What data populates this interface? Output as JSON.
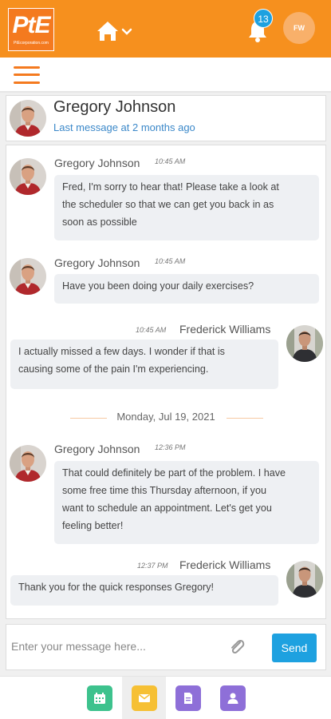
{
  "app": {
    "logo_text": "PtE",
    "logo_subtext": "PtEcorporation.com",
    "notifications_count": "13",
    "user_initials": "FW"
  },
  "conversation": {
    "name": "Gregory Johnson",
    "last_message": "Last message at 2 months ago"
  },
  "messages": [
    {
      "sender": "Gregory Johnson",
      "time": "10:45 AM",
      "side": "left",
      "lines": [
        "Fred, I'm sorry to hear that! Please take a look at",
        "the scheduler so that we can get you back in as",
        "soon as possible"
      ]
    },
    {
      "sender": "Gregory Johnson",
      "time": "10:45 AM",
      "side": "left",
      "lines": [
        "Have you been doing your daily exercises?"
      ]
    },
    {
      "sender": "Frederick Williams",
      "time": "10:45 AM",
      "side": "right",
      "lines": [
        "I actually missed a few days. I wonder if that is",
        "causing some of the pain I'm experiencing."
      ]
    },
    {
      "sender": "Gregory Johnson",
      "time": "12:36 PM",
      "side": "left",
      "lines": [
        "That could definitely be part of the problem. I have",
        "some free time this Thursday afternoon, if you",
        "want to schedule an appointment. Let's get you",
        "feeling better!"
      ]
    },
    {
      "sender": "Frederick Williams",
      "time": "12:37 PM",
      "side": "right",
      "lines": [
        "Thank you for the quick responses Gregory!"
      ]
    }
  ],
  "date_separator": "Monday, Jul 19, 2021",
  "composer": {
    "placeholder": "Enter your message here...",
    "send_label": "Send"
  },
  "bottom_nav": [
    {
      "name": "calendar",
      "icon": "calendar-icon",
      "color": "#3dc28d"
    },
    {
      "name": "messages",
      "icon": "envelope-icon",
      "color": "#f6c034"
    },
    {
      "name": "documents",
      "icon": "document-icon",
      "color": "#8e6fd8"
    },
    {
      "name": "profile",
      "icon": "user-icon",
      "color": "#8e6fd8"
    }
  ],
  "colors": {
    "brand_orange": "#f6901e",
    "accent_blue": "#1ea1e0",
    "link_blue": "#3b88c9",
    "bubble_gray": "#eef0f3"
  }
}
